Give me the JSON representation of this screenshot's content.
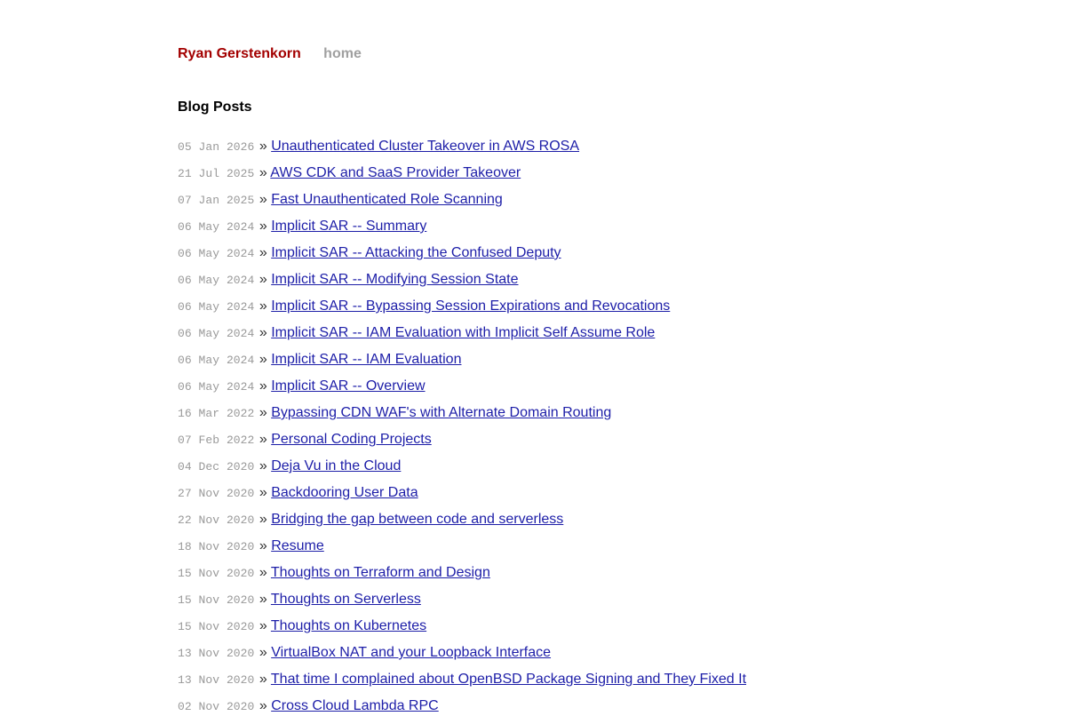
{
  "header": {
    "site_title": "Ryan Gerstenkorn",
    "nav": [
      "home"
    ]
  },
  "section_title": "Blog Posts",
  "separator": "»",
  "posts": [
    {
      "date": "05 Jan 2026",
      "title": "Unauthenticated Cluster Takeover in AWS ROSA"
    },
    {
      "date": "21 Jul 2025",
      "title": "AWS CDK and SaaS Provider Takeover"
    },
    {
      "date": "07 Jan 2025",
      "title": "Fast Unauthenticated Role Scanning"
    },
    {
      "date": "06 May 2024",
      "title": "Implicit SAR -- Summary"
    },
    {
      "date": "06 May 2024",
      "title": "Implicit SAR -- Attacking the Confused Deputy"
    },
    {
      "date": "06 May 2024",
      "title": "Implicit SAR -- Modifying Session State"
    },
    {
      "date": "06 May 2024",
      "title": "Implicit SAR -- Bypassing Session Expirations and Revocations"
    },
    {
      "date": "06 May 2024",
      "title": "Implicit SAR -- IAM Evaluation with Implicit Self Assume Role"
    },
    {
      "date": "06 May 2024",
      "title": "Implicit SAR -- IAM Evaluation"
    },
    {
      "date": "06 May 2024",
      "title": "Implicit SAR -- Overview"
    },
    {
      "date": "16 Mar 2022",
      "title": "Bypassing CDN WAF's with Alternate Domain Routing"
    },
    {
      "date": "07 Feb 2022",
      "title": "Personal Coding Projects"
    },
    {
      "date": "04 Dec 2020",
      "title": "Deja Vu in the Cloud"
    },
    {
      "date": "27 Nov 2020",
      "title": "Backdooring User Data"
    },
    {
      "date": "22 Nov 2020",
      "title": "Bridging the gap between code and serverless"
    },
    {
      "date": "18 Nov 2020",
      "title": "Resume"
    },
    {
      "date": "15 Nov 2020",
      "title": "Thoughts on Terraform and Design"
    },
    {
      "date": "15 Nov 2020",
      "title": "Thoughts on Serverless"
    },
    {
      "date": "15 Nov 2020",
      "title": "Thoughts on Kubernetes"
    },
    {
      "date": "13 Nov 2020",
      "title": "VirtualBox NAT and your Loopback Interface"
    },
    {
      "date": "13 Nov 2020",
      "title": "That time I complained about OpenBSD Package Signing and They Fixed It"
    },
    {
      "date": "02 Nov 2020",
      "title": "Cross Cloud Lambda RPC"
    }
  ],
  "colors": {
    "site_title": "#a30000",
    "nav": "#a0a0a0",
    "link": "#1d1ea8",
    "date": "#999999"
  }
}
